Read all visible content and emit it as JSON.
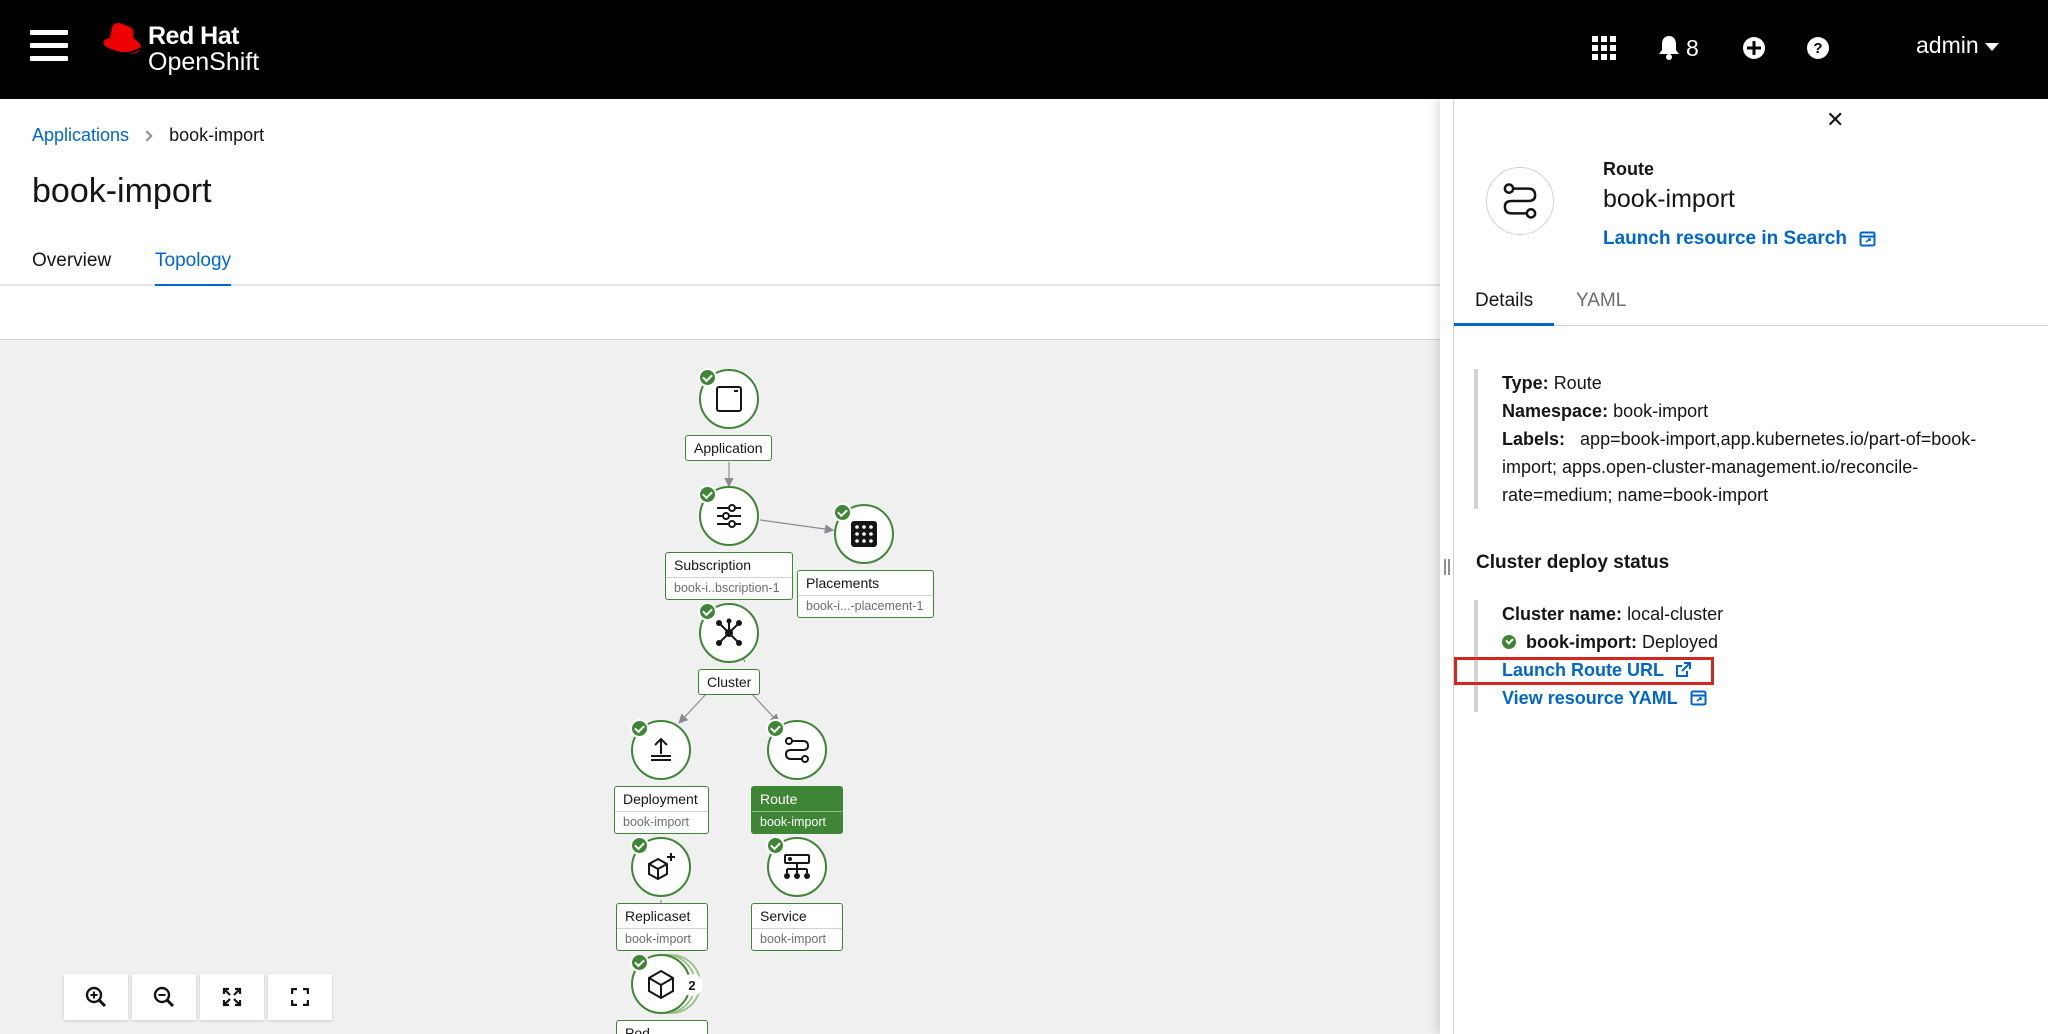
{
  "masthead": {
    "brand_line1": "Red Hat",
    "brand_line2": "OpenShift",
    "notification_count": "8",
    "user": "admin",
    "icons": [
      "menu-icon",
      "apps-grid-icon",
      "bell-icon",
      "plus-circle-icon",
      "help-icon"
    ]
  },
  "breadcrumb": {
    "parent": "Applications",
    "current": "book-import"
  },
  "page": {
    "title": "book-import",
    "tabs": [
      "Overview",
      "Topology"
    ],
    "active_tab": "Topology"
  },
  "topology": {
    "nodes": [
      {
        "title": "Application",
        "subtitle": ""
      },
      {
        "title": "Subscription",
        "subtitle": "book-i..bscription-1"
      },
      {
        "title": "Placements",
        "subtitle": "book-i...-placement-1"
      },
      {
        "title": "Cluster",
        "subtitle": ""
      },
      {
        "title": "Deployment",
        "subtitle": "book-import"
      },
      {
        "title": "Route",
        "subtitle": "book-import"
      },
      {
        "title": "Replicaset",
        "subtitle": "book-import"
      },
      {
        "title": "Service",
        "subtitle": "book-import"
      },
      {
        "title": "Pod",
        "subtitle": ""
      }
    ],
    "pod_count": "2",
    "selected_node": "Route",
    "zoom_controls": [
      "zoom-in-icon",
      "zoom-out-icon",
      "fit-to-screen-icon",
      "expand-icon"
    ]
  },
  "panel": {
    "kind": "Route",
    "name": "book-import",
    "launch_search": "Launch resource in Search",
    "tabs": [
      "Details",
      "YAML"
    ],
    "active_tab": "Details",
    "details": {
      "type_label": "Type:",
      "type_value": "Route",
      "namespace_label": "Namespace:",
      "namespace_value": "book-import",
      "labels_label": "Labels:",
      "labels_line1": "app=book-import,app.kubernetes.io/part-of=book-",
      "labels_line2": "import; apps.open-cluster-management.io/reconcile-",
      "labels_line3": "rate=medium; name=book-import"
    },
    "cluster_status": {
      "title": "Cluster deploy status",
      "cluster_label": "Cluster name:",
      "cluster_value": "local-cluster",
      "resource_label": "book-import:",
      "resource_status": "Deployed",
      "launch_route": "Launch Route URL",
      "view_yaml": "View resource YAML"
    }
  },
  "colors": {
    "accent_blue": "#0066cc",
    "success_green": "#3e8635",
    "highlight_red": "#d3261f"
  }
}
